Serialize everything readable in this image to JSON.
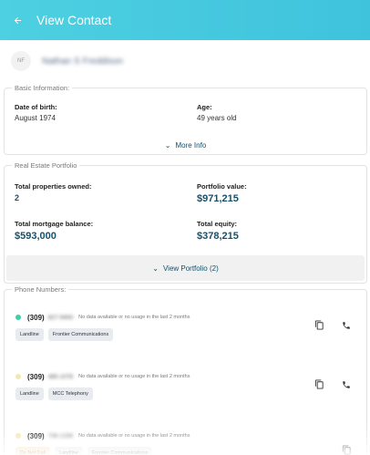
{
  "appbar": {
    "title": "View Contact"
  },
  "contact": {
    "initials": "NF",
    "name": "Nathan S Freddison"
  },
  "basic": {
    "legend": "Basic Information:",
    "dob_label": "Date of birth:",
    "dob_value": "August 1974",
    "age_label": "Age:",
    "age_value": "49 years old",
    "more_info": "More Info"
  },
  "portfolio": {
    "legend": "Real Estate Portfolio",
    "owned_label": "Total properties owned:",
    "owned_value": "2",
    "value_label": "Portfolio value:",
    "value_value": "$971,215",
    "mortgage_label": "Total mortgage balance:",
    "mortgage_value": "$593,000",
    "equity_label": "Total equity:",
    "equity_value": "$378,215",
    "view_button": "View Portfolio (2)"
  },
  "phones": {
    "legend": "Phone Numbers:",
    "items": [
      {
        "area": "(309)",
        "masked": "827-9493",
        "note": "No data available or no usage in the last 2 months",
        "dot_color": "#3fd0a8",
        "tags": [
          "Landline",
          "Frontier Communications"
        ],
        "dnc": ""
      },
      {
        "area": "(309)",
        "masked": "485-1078",
        "note": "No data available or no usage in the last 2 months",
        "dot_color": "#f3e9b0",
        "tags": [
          "Landline",
          "MCC Telephony"
        ],
        "dnc": ""
      },
      {
        "area": "(309)",
        "masked": "736-1338",
        "note": "No data available or no usage in the last 2 months",
        "dot_color": "#f3e9b0",
        "tags": [
          "Landline",
          "Frontier Communications"
        ],
        "dnc": "Do Not Call"
      }
    ]
  },
  "colors": {
    "appbar": "#4dd0e1",
    "accent": "#16506b"
  },
  "icons": {
    "back": "arrow-back-icon",
    "copy": "copy-icon",
    "phone": "phone-icon",
    "chevron": "chevron-down-icon"
  }
}
